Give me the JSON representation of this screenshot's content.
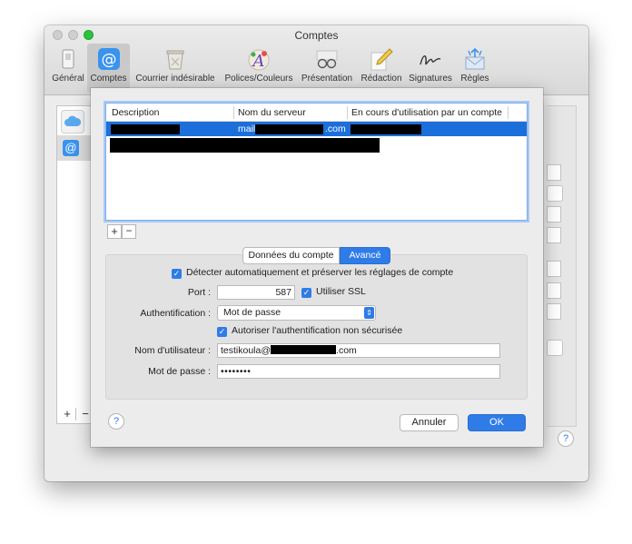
{
  "window": {
    "title": "Comptes"
  },
  "toolbar": {
    "items": [
      {
        "label": "Général",
        "icon": "switch-icon"
      },
      {
        "label": "Comptes",
        "icon": "at-sign-icon"
      },
      {
        "label": "Courrier indésirable",
        "icon": "junk-trash-icon"
      },
      {
        "label": "Polices/Couleurs",
        "icon": "fonts-colors-icon"
      },
      {
        "label": "Présentation",
        "icon": "glasses-icon"
      },
      {
        "label": "Rédaction",
        "icon": "pencil-icon"
      },
      {
        "label": "Signatures",
        "icon": "signature-icon"
      },
      {
        "label": "Règles",
        "icon": "rules-envelope-icon"
      }
    ],
    "selected": "Comptes"
  },
  "sheet": {
    "table": {
      "columns": [
        "Description",
        "Nom du serveur",
        "En cours d'utilisation par un compte"
      ],
      "rows": [
        {
          "server_prefix": "mail.",
          "server_suffix": ".com"
        }
      ]
    },
    "tabs": [
      "Données du compte",
      "Avancé"
    ],
    "active_tab": "Avancé",
    "advanced": {
      "auto_detect_label": "Détecter automatiquement et préserver les réglages de compte",
      "port_label": "Port :",
      "port_value": "587",
      "use_ssl_label": "Utiliser SSL",
      "auth_label": "Authentification :",
      "auth_value": "Mot de passe",
      "allow_insecure_label": "Autoriser l'authentification non sécurisée",
      "username_label": "Nom d'utilisateur :",
      "username_prefix": "testikoula@",
      "username_suffix": ".com",
      "password_label": "Mot de passe :",
      "password_value": "••••••••"
    },
    "buttons": {
      "cancel": "Annuler",
      "ok": "OK"
    }
  },
  "list_controls": {
    "add": "+",
    "remove": "−"
  },
  "colors": {
    "accent": "#2f7ce8",
    "selection": "#1c6fdb"
  }
}
